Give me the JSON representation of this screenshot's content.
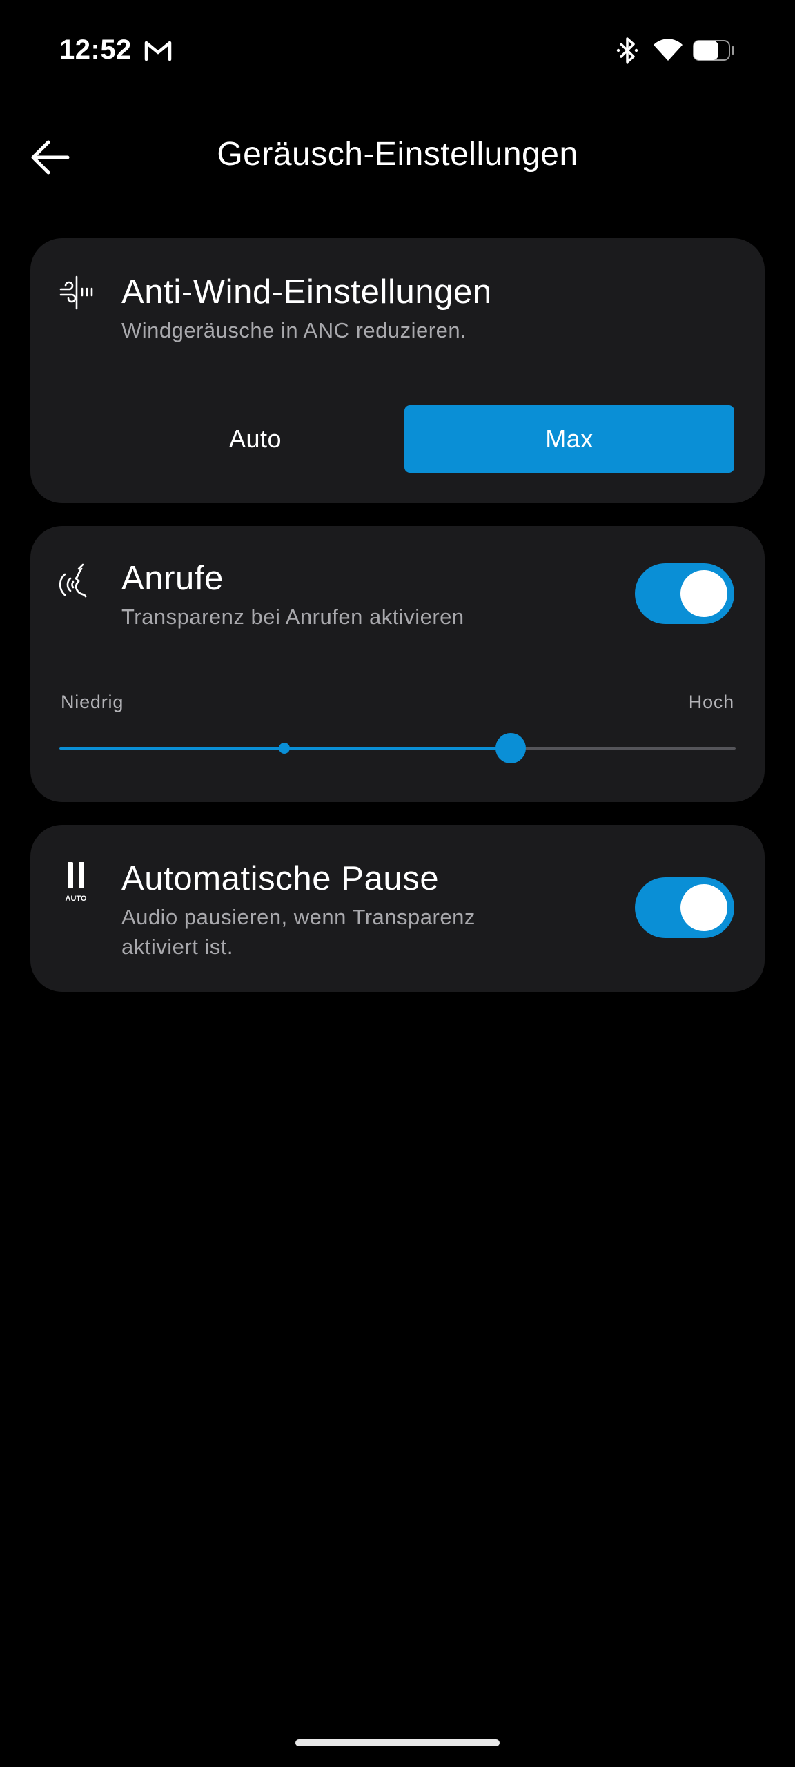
{
  "status_bar": {
    "time": "12:52",
    "icons": [
      "gmail-icon",
      "bluetooth-icon",
      "wifi-icon",
      "battery-icon"
    ]
  },
  "header": {
    "back_icon": "arrow-left-icon",
    "title": "Geräusch-Einstellungen"
  },
  "anti_wind": {
    "icon": "wind-icon",
    "title": "Anti-Wind-Einstellungen",
    "subtitle": "Windgeräusche in ANC reduzieren.",
    "options": [
      "Auto",
      "Max"
    ],
    "selected": "Max"
  },
  "calls": {
    "icon": "voice-icon",
    "title": "Anrufe",
    "subtitle": "Transparenz bei Anrufen aktivieren",
    "toggle_on": true,
    "slider": {
      "low_label": "Niedrig",
      "high_label": "Hoch",
      "value": 0.667,
      "default_marker": 0.333
    }
  },
  "auto_pause": {
    "icon": "pause-auto-icon",
    "icon_caption": "AUTO",
    "title": "Automatische Pause",
    "subtitle": "Audio pausieren, wenn Transparenz aktiviert ist.",
    "toggle_on": true
  },
  "colors": {
    "accent": "#0a8fd6",
    "card_bg": "#1b1b1d",
    "background": "#000000",
    "secondary_text": "#a9a9ad"
  }
}
